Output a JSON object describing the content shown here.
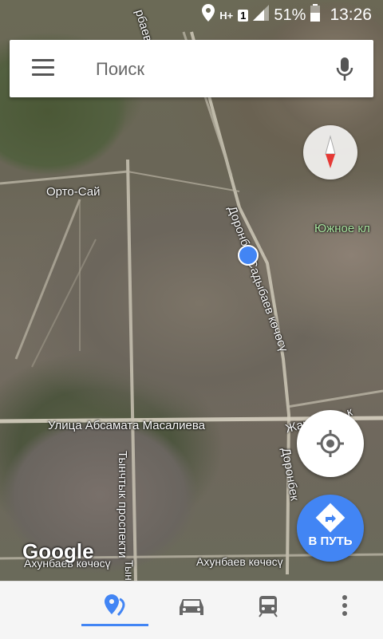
{
  "status_bar": {
    "network_label": "H+",
    "sim_label": "1",
    "battery_percent": "51%",
    "time": "13:26"
  },
  "search": {
    "placeholder": "Поиск"
  },
  "map": {
    "labels": {
      "orto_sai": "Орто-Сай",
      "yuzhnoe": "Южное кл",
      "doronbek_1": "Доронбек Садыбаев көчөсү",
      "doronbek_2": "Доронбек",
      "doronbek_2b": "Садыбаев к",
      "absamat": "Улица Абсамата Масалиева",
      "tynchtyk": "Тынчтык проспекти",
      "zhakypyra": "Жакыпыра к",
      "akhunbaev_left": "Ахунбаев көчөсү",
      "akhunbaev_right": "Ахунбаев көчөсү",
      "fabek_top": "рбаев к",
      "tyn_cut": "Тын"
    }
  },
  "fab": {
    "directions_label": "В ПУТЬ"
  },
  "branding": {
    "logo_text": "Google"
  },
  "bottom_tabs": [
    {
      "name": "explore",
      "icon": "location-pin-icon",
      "active": true
    },
    {
      "name": "driving",
      "icon": "car-icon",
      "active": false
    },
    {
      "name": "transit",
      "icon": "train-icon",
      "active": false
    },
    {
      "name": "more",
      "icon": "more-vertical-icon",
      "active": false
    }
  ],
  "colors": {
    "accent": "#4285f4",
    "compass_red": "#e53935"
  }
}
